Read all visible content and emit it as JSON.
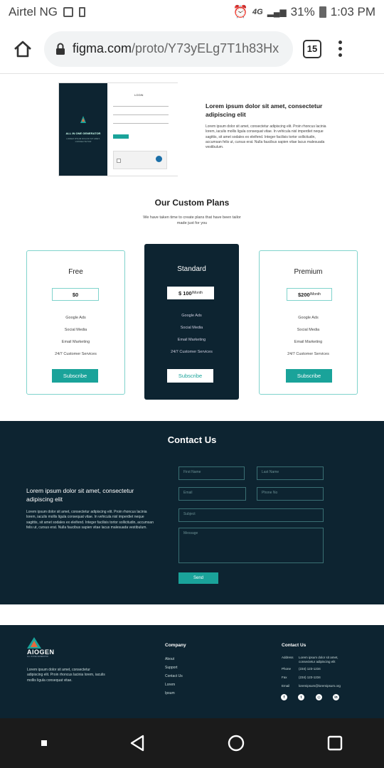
{
  "status_bar": {
    "carrier": "Airtel NG",
    "network": "4G",
    "battery": "31%",
    "time": "1:03 PM"
  },
  "browser": {
    "url_host": "figma.com",
    "url_path": "/proto/Y73yELg7T1h83Hx",
    "tab_count": "15"
  },
  "hero": {
    "mock_title": "LOGIN",
    "mock_brand": "ALL IN ONE GENERATOR",
    "mock_sub": "LOREM IPSUM DOLOR SIT AMET, CONSECTETUR",
    "title": "Lorem ipsum dolor sit amet, consectetur adipiscing elit",
    "body": "Lorem ipsum dolor sit amet, consectetur adipiscing elit. Proin rhoncus lacinia lorem, iaculis mollis ligula consequat vitae. In vehicula nisl imperdiet neque sagittis, sit amet sodales ex eleifend. Integer facilisis tortor sollicitudin, accumsan felis ut, cursus erat. Nulla faucibus sapien vitae lacus malesuada vestibulum."
  },
  "plans": {
    "title": "Our Custom Plans",
    "subtitle": "We have taken time to create plans that have been tailor made just for you",
    "cards": [
      {
        "name": "Free",
        "price": "$0",
        "per": "",
        "features": [
          "Google Ads",
          "Social Media",
          "Email Marketing",
          "24/7 Customer Services"
        ],
        "button": "Subscribe"
      },
      {
        "name": "Standard",
        "price": "$ 100",
        "per": "/Month",
        "features": [
          "Google Ads",
          "Social Media",
          "Email Marketing",
          "24/7 Customer Services"
        ],
        "button": "Subscribe"
      },
      {
        "name": "Premium",
        "price": "$200",
        "per": "/Month",
        "features": [
          "Google Ads",
          "Social Media",
          "Email Marketing",
          "24/7 Customer Services"
        ],
        "button": "Subscribe"
      }
    ]
  },
  "contact": {
    "title": "Contact Us",
    "heading": "Lorem ipsum dolor sit amet, consectetur adipiscing elit",
    "body": "Lorem ipsum dolor sit amet, consectetur adipiscing elit. Proin rhoncus lacinia lorem, iaculis mollis ligula consequat vitae. In vehicula nisl imperdiet neque sagittis, sit amet sodales ex eleifend. Integer facilisis tortor sollicitudin, accumsan felis ut, cursus erat. Nulla faucibus sapien vitae lacus malesuada vestibulum.",
    "first_name": "First Name",
    "last_name": "Last Name",
    "email": "Email",
    "phone": "Phone No",
    "subject": "Subject",
    "message": "Message",
    "send": "Send"
  },
  "footer": {
    "logo_text": "AIOGEN",
    "tagline": "ALL IN ONE GENERATOR",
    "desc": "Lorem ipsum dolor sit amet, consectetur adipiscing elit. Proin rhoncus lacinia lorem, iaculis mollis ligula consequat vitae.",
    "company_title": "Company",
    "company_links": [
      "About",
      "Support",
      "Contact Us",
      "Lorem",
      "Ipsum"
    ],
    "contact_title": "Contact Us",
    "address_label": "Address",
    "address_value": "Lorem ipsum dolor sit amet, consectetur adipiscing elit",
    "phone_label": "Phone",
    "phone_value": "(234) 123-1234",
    "fax_label": "Fax",
    "fax_value": "(234) 123-1234",
    "email_label": "Email",
    "email_value": "loremipsum@loremipsum.org"
  },
  "colors": {
    "teal": "#1aa39a",
    "navy": "#0d2431"
  }
}
